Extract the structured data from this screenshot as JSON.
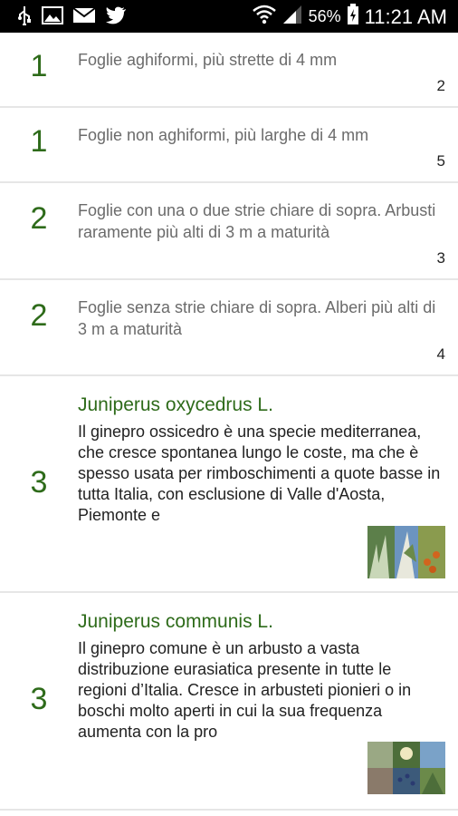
{
  "status_bar": {
    "battery_percent": "56%",
    "time": "11:21 AM",
    "left_icons": [
      "usb-icon",
      "image-icon",
      "mail-icon",
      "twitter-icon"
    ],
    "right_icons": [
      "wifi-icon",
      "signal-icon",
      "battery-icon"
    ]
  },
  "key_rows": [
    {
      "step": "1",
      "text": "Foglie aghiformi, più strette di 4 mm",
      "target": "2"
    },
    {
      "step": "1",
      "text": "Foglie non aghiformi, più larghe di 4 mm",
      "target": "5"
    },
    {
      "step": "2",
      "text": "Foglie con una o due strie chiare di sopra. Arbusti raramente più alti di 3 m a maturità",
      "target": "3"
    },
    {
      "step": "2",
      "text": "Foglie senza strie chiare di sopra. Alberi più alti di 3 m a maturità",
      "target": "4"
    }
  ],
  "species": [
    {
      "step": "3",
      "name": "Juniperus oxycedrus L.",
      "description": "Il ginepro ossicedro è una specie mediterranea, che cresce spontanea lungo le coste, ma che è spesso usata per rimboschimenti a quote basse in tutta Italia, con esclusione di Valle d'Aosta, Piemonte e"
    },
    {
      "step": "3",
      "name": "Juniperus communis L.",
      "description": "Il ginepro comune è un arbusto a vasta distribuzione eurasiatica presente in tutte le regioni d’Italia. Cresce in arbusteti pionieri o in boschi molto aperti in cui la sua frequenza aumenta con la pro"
    }
  ]
}
